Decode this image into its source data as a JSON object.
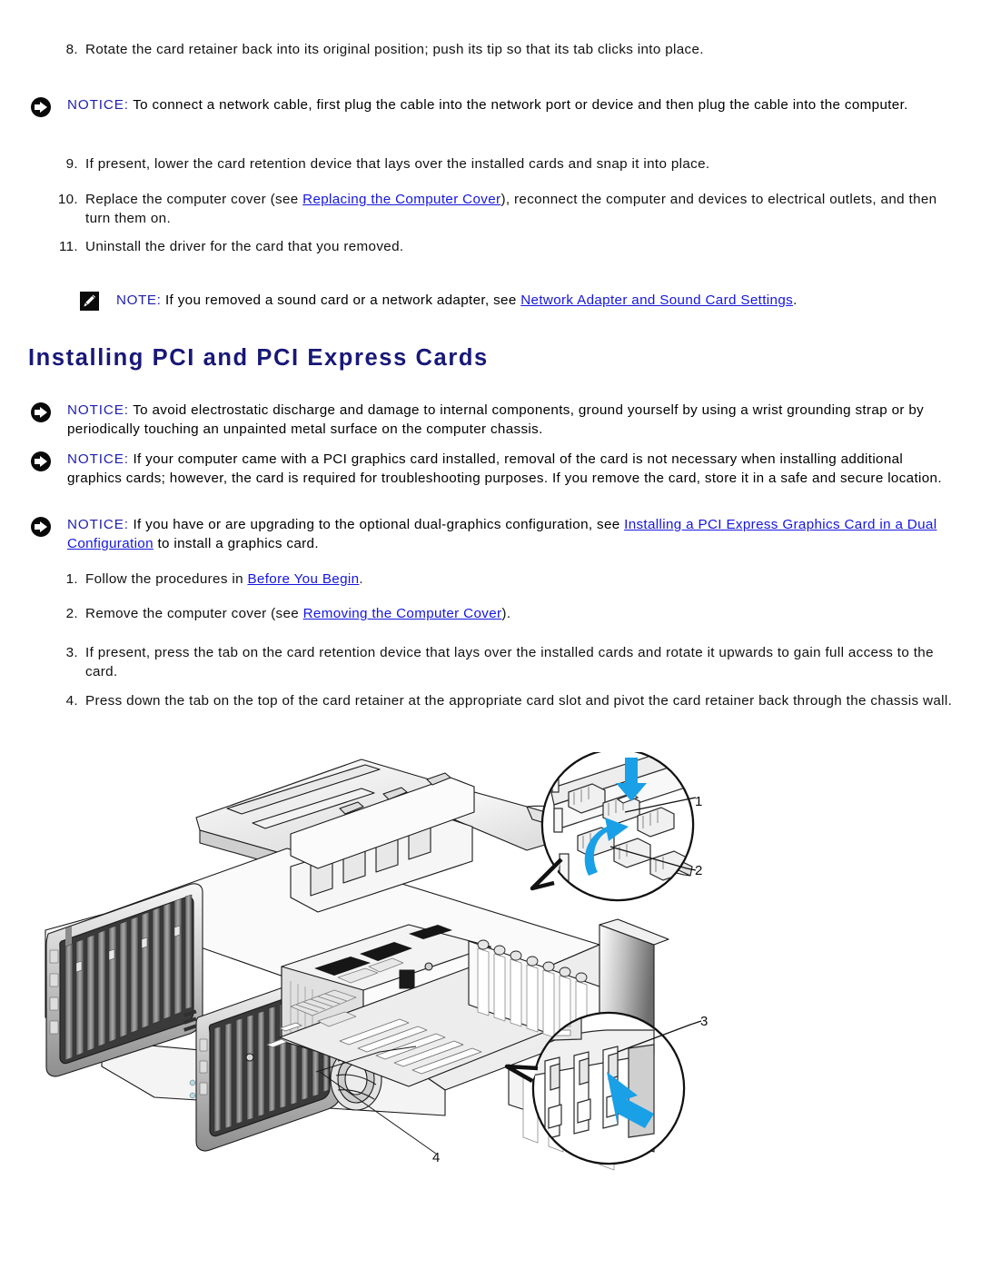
{
  "document": {
    "heading": "Installing PCI and PCI Express Cards"
  },
  "steps_top": [
    {
      "num": "8.",
      "text": "Rotate the card retainer back into its original position; push its tip so that its tab clicks into place."
    },
    {
      "num": "9.",
      "text": "If present, lower the card retention device that lays over the installed cards and snap it into place."
    },
    {
      "num": "10.",
      "text_before": "Replace the computer cover (see ",
      "link": "Replacing the Computer Cover",
      "text_after": "), reconnect the computer and devices to electrical outlets, and then turn them on."
    },
    {
      "num": "11.",
      "text": "Uninstall the driver for the card that you removed."
    }
  ],
  "alerts_top": [
    {
      "icon": "notice-icon",
      "keyword": "NOTICE:",
      "text": " To connect a network cable, first plug the cable into the network port or device and then plug the cable into the computer."
    }
  ],
  "note_top": {
    "icon": "note-pencil-icon",
    "keyword": "NOTE:",
    "text_before": " If you removed a sound card or a network adapter, see ",
    "link": "Network Adapter and Sound Card Settings",
    "text_after": "."
  },
  "alerts_section": [
    {
      "icon": "notice-icon",
      "keyword": "NOTICE:",
      "text": " To avoid electrostatic discharge and damage to internal components, ground yourself by using a wrist grounding strap or by periodically touching an unpainted metal surface on the computer chassis."
    },
    {
      "icon": "notice-icon",
      "keyword": "NOTICE:",
      "text": " If your computer came with a PCI graphics card installed, removal of the card is not necessary when installing additional graphics cards; however, the card is required for troubleshooting purposes. If you remove the card, store it in a safe and secure location."
    },
    {
      "icon": "notice-icon",
      "keyword": "NOTICE:",
      "text_before": " If you have or are upgrading to the optional dual-graphics configuration, see ",
      "link": "Installing a PCI Express Graphics Card in a Dual Configuration",
      "text_after": " to install a graphics card."
    }
  ],
  "steps_section": [
    {
      "num": "1.",
      "text_before": "Follow the procedures in ",
      "link": "Before You Begin",
      "text_after": "."
    },
    {
      "num": "2.",
      "text_before": "Remove the computer cover (see ",
      "link": "Removing the Computer Cover",
      "text_after": ")."
    },
    {
      "num": "3.",
      "text": "If present, press the tab on the card retention device that lays over the installed cards and rotate it upwards to gain full access to the card."
    },
    {
      "num": "4.",
      "text": "Press down the tab on the top of the card retainer at the appropriate card slot and pivot the card retainer back through the chassis wall."
    }
  ],
  "figure": {
    "callouts": [
      {
        "label": "1"
      },
      {
        "label": "2"
      },
      {
        "label": "3"
      },
      {
        "label": "4"
      }
    ],
    "colors": {
      "arrow_blue": "#19A0E6",
      "line": "#1a1a1a",
      "fill_light": "#f2f2f2",
      "fill_mid": "#d8d8d8",
      "fill_dark": "#9a9a9a"
    }
  }
}
